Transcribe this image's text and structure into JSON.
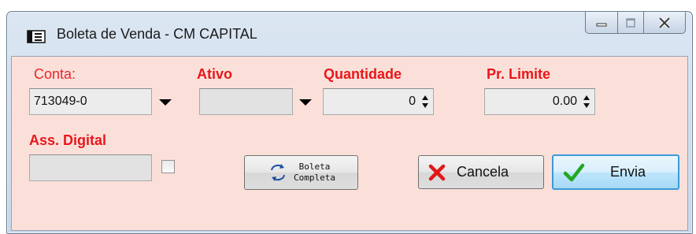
{
  "window": {
    "title": "Boleta de Venda - CM CAPITAL",
    "icon": "window-icon",
    "caption_buttons": [
      "minimize-icon",
      "maximize-icon",
      "close-icon"
    ]
  },
  "form": {
    "conta": {
      "label": "Conta:",
      "value": "713049-0"
    },
    "ativo": {
      "label": "Ativo",
      "value": ""
    },
    "quantidade": {
      "label": "Quantidade",
      "value": "0"
    },
    "pr_limite": {
      "label": "Pr. Limite",
      "value": "0.00"
    },
    "ass_digital": {
      "label": "Ass. Digital",
      "value": "",
      "checked": false
    }
  },
  "buttons": {
    "boleta_completa_line1": "Boleta",
    "boleta_completa_line2": "Completa",
    "cancela": "Cancela",
    "envia": "Envia"
  },
  "colors": {
    "form_background": "#fbe0da",
    "label_red": "#e8171b",
    "cancel_icon": "#e01818",
    "ok_icon": "#22a722",
    "default_button_border": "#3c9ad7"
  }
}
